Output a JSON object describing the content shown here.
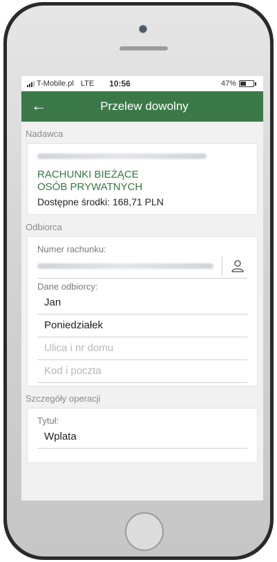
{
  "status_bar": {
    "carrier": "T-Mobile.pl",
    "network": "LTE",
    "time": "10:56",
    "battery": "47%",
    "battery_level": 0.47
  },
  "header": {
    "back_icon": "arrow-left-icon",
    "title": "Przelew dowolny"
  },
  "sender": {
    "section_label": "Nadawca",
    "account_name_line1": "RACHUNKI BIEŻĄCE",
    "account_name_line2": "OSÓB PRYWATNYCH",
    "available_funds": "Dostępne środki: 168,71 PLN"
  },
  "recipient": {
    "section_label": "Odbiorca",
    "account_number_label": "Numer rachunku:",
    "contacts_icon": "person-icon",
    "recipient_data_label": "Dane odbiorcy:",
    "first_name": "Jan",
    "last_name": "Poniedziałek",
    "street_placeholder": "Ulica i nr domu",
    "postal_placeholder": "Kod i poczta"
  },
  "details": {
    "section_label": "Szczegóły operacji",
    "title_label": "Tytuł:",
    "title_value": "Wplata"
  },
  "colors": {
    "header": "#3b7a48",
    "account_name": "#2f7a40"
  }
}
